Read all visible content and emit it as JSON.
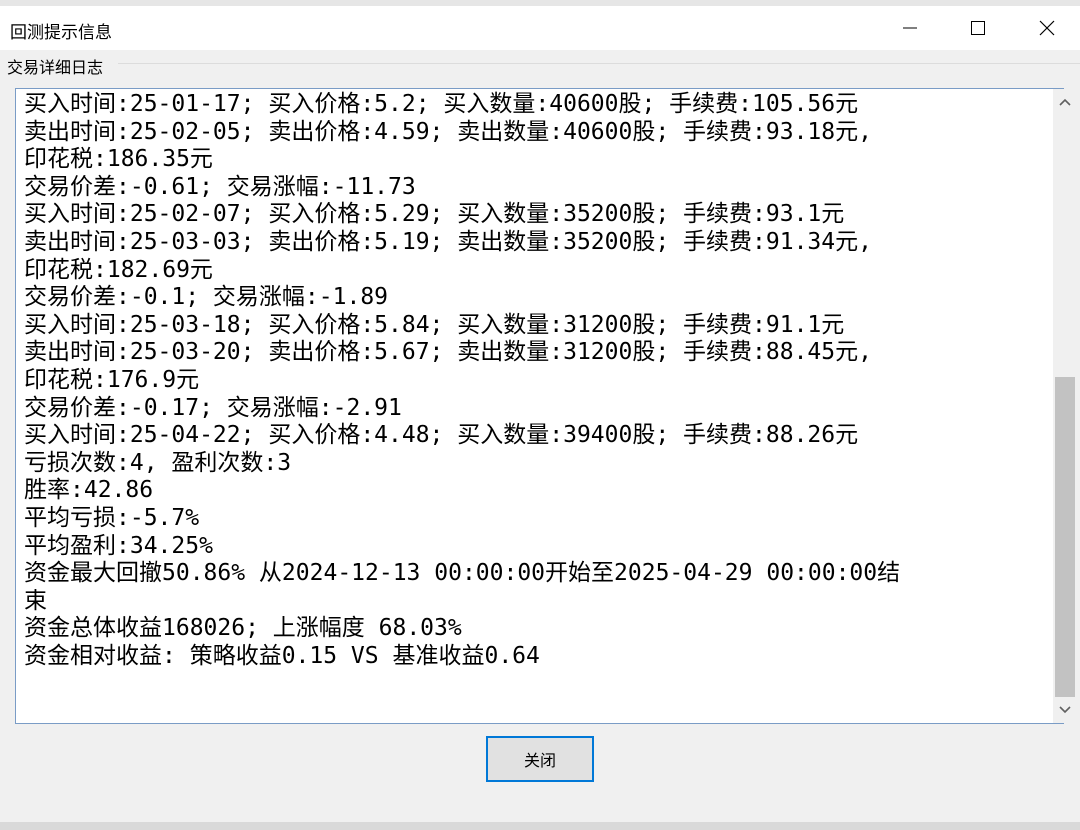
{
  "window": {
    "title": "回测提示信息",
    "group_label": "交易详细日志"
  },
  "log_lines": [
    "买入时间:25-01-17; 买入价格:5.2; 买入数量:40600股; 手续费:105.56元",
    "卖出时间:25-02-05; 卖出价格:4.59; 卖出数量:40600股; 手续费:93.18元,",
    "印花税:186.35元",
    "交易价差:-0.61; 交易涨幅:-11.73",
    "买入时间:25-02-07; 买入价格:5.29; 买入数量:35200股; 手续费:93.1元",
    "卖出时间:25-03-03; 卖出价格:5.19; 卖出数量:35200股; 手续费:91.34元,",
    "印花税:182.69元",
    "交易价差:-0.1; 交易涨幅:-1.89",
    "买入时间:25-03-18; 买入价格:5.84; 买入数量:31200股; 手续费:91.1元",
    "卖出时间:25-03-20; 卖出价格:5.67; 卖出数量:31200股; 手续费:88.45元,",
    "印花税:176.9元",
    "交易价差:-0.17; 交易涨幅:-2.91",
    "买入时间:25-04-22; 买入价格:4.48; 买入数量:39400股; 手续费:88.26元",
    "亏损次数:4, 盈利次数:3",
    "胜率:42.86",
    "平均亏损:-5.7%",
    "平均盈利:34.25%",
    "资金最大回撤50.86% 从2024-12-13 00:00:00开始至2025-04-29 00:00:00结",
    "束",
    "资金总体收益168026; 上涨幅度 68.03%",
    "资金相对收益: 策略收益0.15 VS 基准收益0.64"
  ],
  "buttons": {
    "close_label": "关闭"
  },
  "colors": {
    "focus_border": "#0078d7",
    "textbox_border": "#7a9cc6"
  }
}
